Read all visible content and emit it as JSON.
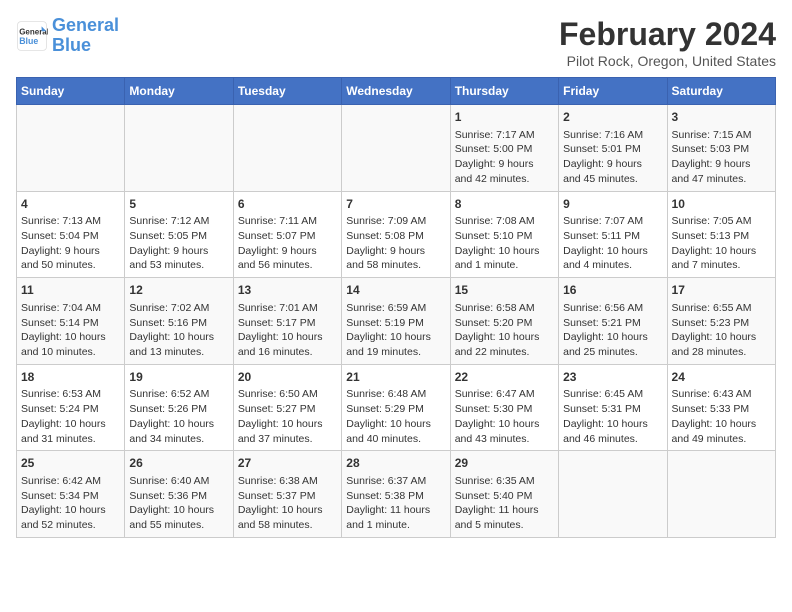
{
  "header": {
    "logo_line1": "General",
    "logo_line2": "Blue",
    "main_title": "February 2024",
    "subtitle": "Pilot Rock, Oregon, United States"
  },
  "weekdays": [
    "Sunday",
    "Monday",
    "Tuesday",
    "Wednesday",
    "Thursday",
    "Friday",
    "Saturday"
  ],
  "weeks": [
    [
      {
        "day": "",
        "info": ""
      },
      {
        "day": "",
        "info": ""
      },
      {
        "day": "",
        "info": ""
      },
      {
        "day": "",
        "info": ""
      },
      {
        "day": "1",
        "info": "Sunrise: 7:17 AM\nSunset: 5:00 PM\nDaylight: 9 hours\nand 42 minutes."
      },
      {
        "day": "2",
        "info": "Sunrise: 7:16 AM\nSunset: 5:01 PM\nDaylight: 9 hours\nand 45 minutes."
      },
      {
        "day": "3",
        "info": "Sunrise: 7:15 AM\nSunset: 5:03 PM\nDaylight: 9 hours\nand 47 minutes."
      }
    ],
    [
      {
        "day": "4",
        "info": "Sunrise: 7:13 AM\nSunset: 5:04 PM\nDaylight: 9 hours\nand 50 minutes."
      },
      {
        "day": "5",
        "info": "Sunrise: 7:12 AM\nSunset: 5:05 PM\nDaylight: 9 hours\nand 53 minutes."
      },
      {
        "day": "6",
        "info": "Sunrise: 7:11 AM\nSunset: 5:07 PM\nDaylight: 9 hours\nand 56 minutes."
      },
      {
        "day": "7",
        "info": "Sunrise: 7:09 AM\nSunset: 5:08 PM\nDaylight: 9 hours\nand 58 minutes."
      },
      {
        "day": "8",
        "info": "Sunrise: 7:08 AM\nSunset: 5:10 PM\nDaylight: 10 hours\nand 1 minute."
      },
      {
        "day": "9",
        "info": "Sunrise: 7:07 AM\nSunset: 5:11 PM\nDaylight: 10 hours\nand 4 minutes."
      },
      {
        "day": "10",
        "info": "Sunrise: 7:05 AM\nSunset: 5:13 PM\nDaylight: 10 hours\nand 7 minutes."
      }
    ],
    [
      {
        "day": "11",
        "info": "Sunrise: 7:04 AM\nSunset: 5:14 PM\nDaylight: 10 hours\nand 10 minutes."
      },
      {
        "day": "12",
        "info": "Sunrise: 7:02 AM\nSunset: 5:16 PM\nDaylight: 10 hours\nand 13 minutes."
      },
      {
        "day": "13",
        "info": "Sunrise: 7:01 AM\nSunset: 5:17 PM\nDaylight: 10 hours\nand 16 minutes."
      },
      {
        "day": "14",
        "info": "Sunrise: 6:59 AM\nSunset: 5:19 PM\nDaylight: 10 hours\nand 19 minutes."
      },
      {
        "day": "15",
        "info": "Sunrise: 6:58 AM\nSunset: 5:20 PM\nDaylight: 10 hours\nand 22 minutes."
      },
      {
        "day": "16",
        "info": "Sunrise: 6:56 AM\nSunset: 5:21 PM\nDaylight: 10 hours\nand 25 minutes."
      },
      {
        "day": "17",
        "info": "Sunrise: 6:55 AM\nSunset: 5:23 PM\nDaylight: 10 hours\nand 28 minutes."
      }
    ],
    [
      {
        "day": "18",
        "info": "Sunrise: 6:53 AM\nSunset: 5:24 PM\nDaylight: 10 hours\nand 31 minutes."
      },
      {
        "day": "19",
        "info": "Sunrise: 6:52 AM\nSunset: 5:26 PM\nDaylight: 10 hours\nand 34 minutes."
      },
      {
        "day": "20",
        "info": "Sunrise: 6:50 AM\nSunset: 5:27 PM\nDaylight: 10 hours\nand 37 minutes."
      },
      {
        "day": "21",
        "info": "Sunrise: 6:48 AM\nSunset: 5:29 PM\nDaylight: 10 hours\nand 40 minutes."
      },
      {
        "day": "22",
        "info": "Sunrise: 6:47 AM\nSunset: 5:30 PM\nDaylight: 10 hours\nand 43 minutes."
      },
      {
        "day": "23",
        "info": "Sunrise: 6:45 AM\nSunset: 5:31 PM\nDaylight: 10 hours\nand 46 minutes."
      },
      {
        "day": "24",
        "info": "Sunrise: 6:43 AM\nSunset: 5:33 PM\nDaylight: 10 hours\nand 49 minutes."
      }
    ],
    [
      {
        "day": "25",
        "info": "Sunrise: 6:42 AM\nSunset: 5:34 PM\nDaylight: 10 hours\nand 52 minutes."
      },
      {
        "day": "26",
        "info": "Sunrise: 6:40 AM\nSunset: 5:36 PM\nDaylight: 10 hours\nand 55 minutes."
      },
      {
        "day": "27",
        "info": "Sunrise: 6:38 AM\nSunset: 5:37 PM\nDaylight: 10 hours\nand 58 minutes."
      },
      {
        "day": "28",
        "info": "Sunrise: 6:37 AM\nSunset: 5:38 PM\nDaylight: 11 hours\nand 1 minute."
      },
      {
        "day": "29",
        "info": "Sunrise: 6:35 AM\nSunset: 5:40 PM\nDaylight: 11 hours\nand 5 minutes."
      },
      {
        "day": "",
        "info": ""
      },
      {
        "day": "",
        "info": ""
      }
    ]
  ]
}
